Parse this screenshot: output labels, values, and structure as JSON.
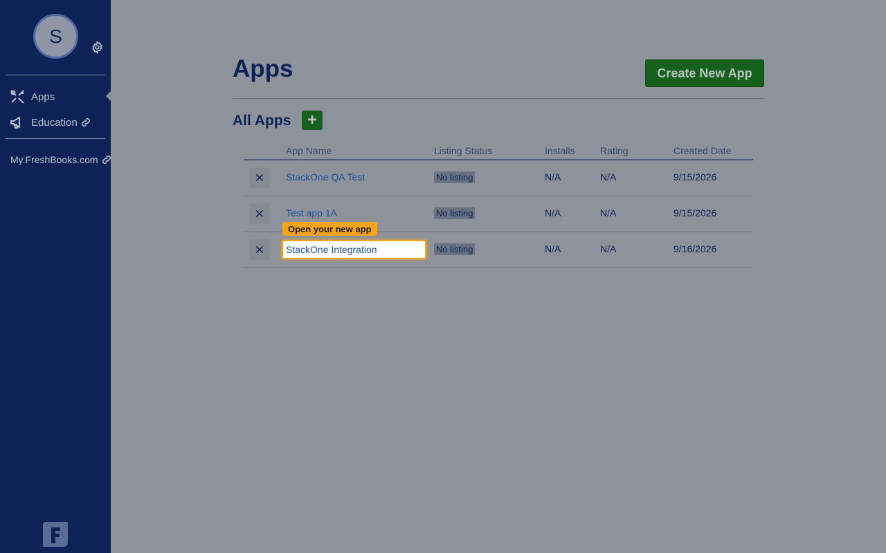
{
  "sidebar": {
    "avatar_initial": "S",
    "items": [
      {
        "label": "Apps",
        "icon": "tools-icon"
      },
      {
        "label": "Education",
        "icon": "megaphone-icon"
      },
      {
        "label": "My.FreshBooks.com",
        "icon": "link-icon"
      }
    ],
    "logo": "freshbooks-logo"
  },
  "header": {
    "title": "Apps",
    "create_button": "Create New App"
  },
  "section": {
    "title": "All Apps",
    "add_button": "+"
  },
  "table": {
    "columns": [
      "App Name",
      "Listing Status",
      "Installs",
      "Rating",
      "Created Date"
    ],
    "rows": [
      {
        "name": "StackOne QA Test",
        "status": "No listing",
        "installs": "N/A",
        "rating": "N/A",
        "created": "9/15/2026"
      },
      {
        "name": "Test app 1A",
        "status": "No listing",
        "installs": "N/A",
        "rating": "N/A",
        "created": "9/15/2026"
      },
      {
        "name": "StackOne Integration",
        "status": "No listing",
        "installs": "N/A",
        "rating": "N/A",
        "created": "9/16/2026"
      }
    ]
  },
  "tooltip": "Open your new app",
  "colors": {
    "sidebar": "#0d2257",
    "accent_green": "#14601c",
    "highlight": "#f4a51c"
  }
}
